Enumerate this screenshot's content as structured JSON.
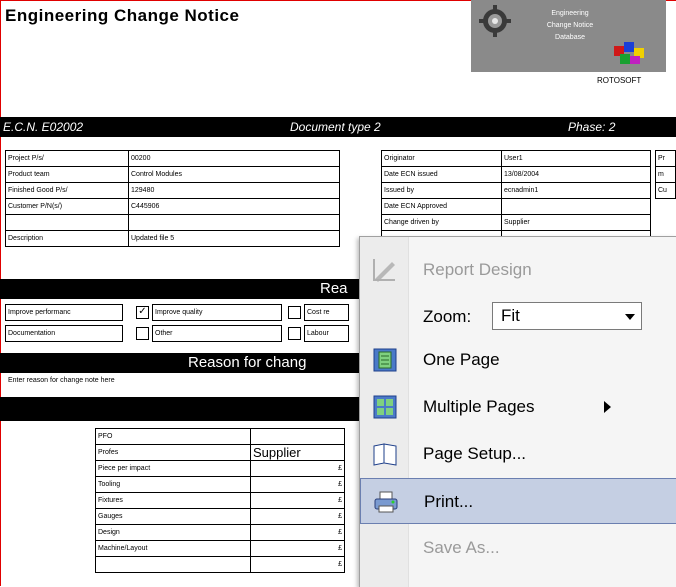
{
  "document": {
    "title": "Engineering Change Notice",
    "logo_lines": [
      "Engineering",
      "Change Notice",
      "Database"
    ],
    "company": "ROTOSOFT",
    "ecn_number": "E.C.N. E02002",
    "document_type": "Document type 2",
    "phase": "Phase:  2",
    "left_rows": [
      [
        "Project P/s/",
        "00200"
      ],
      [
        "Product team",
        "Control Modules"
      ],
      [
        "Finished Good P/s/",
        "129480"
      ],
      [
        "Customer P/N(s/)",
        "C445906"
      ],
      [
        "",
        ""
      ],
      [
        "Description",
        "Updated file 5"
      ]
    ],
    "right_rows": [
      [
        "Originator",
        "User1"
      ],
      [
        "Date ECN issued",
        "13/08/2004"
      ],
      [
        "Issued by",
        "ecnadmin1"
      ],
      [
        "Date ECN Approved",
        ""
      ],
      [
        "Change driven by",
        "Supplier"
      ],
      [
        "",
        ""
      ]
    ],
    "right_edge_labels": [
      "Pr",
      "m",
      "Cu"
    ],
    "reason_header": "Rea",
    "reasons_row1": [
      "Improve performanc",
      "Improve quality",
      "Cost re"
    ],
    "reasons_row2": [
      "Documentation",
      "Other",
      "Labour"
    ],
    "reason_change_header": "Reason for chang",
    "reason_note": "Enter reason for change note here",
    "cost_rows": [
      "PFO",
      "Profes",
      "Piece per impact",
      "Tooling",
      "Fixtures",
      "Gauges",
      "Design",
      "Machine/Layout",
      ""
    ],
    "cost_value_supplier": "Supplier",
    "cost_symbol": "£"
  },
  "context_menu": {
    "items": [
      {
        "label": "Report Design",
        "icon": "report-design-icon",
        "disabled": true
      },
      {
        "label": "Zoom:",
        "icon": "",
        "zoom_value": "Fit"
      },
      {
        "label": "One Page",
        "icon": "one-page-icon"
      },
      {
        "label": "Multiple Pages",
        "icon": "multiple-pages-icon"
      },
      {
        "label": "Page Setup...",
        "icon": "page-setup-icon"
      },
      {
        "label": "Print...",
        "icon": "print-icon",
        "highlighted": true
      },
      {
        "label": "Save As...",
        "icon": "",
        "disabled": true
      }
    ]
  },
  "colors": {
    "highlight": "#c5cfe3",
    "highlight_border": "#6b7fb0",
    "menu_bg": "#f5f5f5",
    "header_bar": "#000000"
  }
}
